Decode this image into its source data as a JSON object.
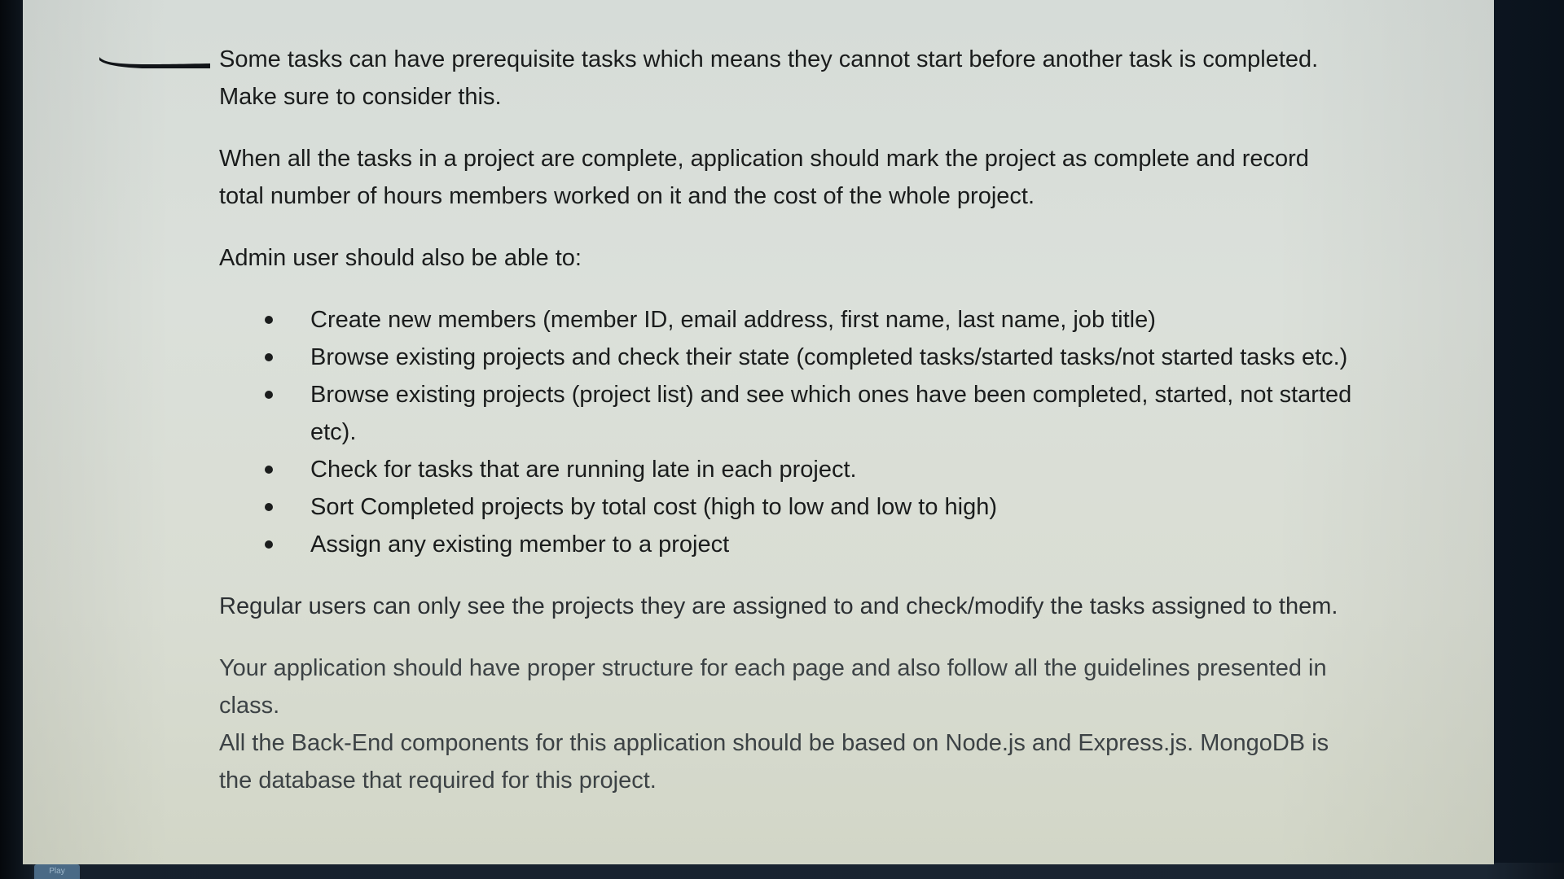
{
  "document": {
    "paragraphs_top": [
      "Some tasks can have prerequisite tasks which means they cannot start before another task is completed. Make sure to consider this.",
      "When all the tasks in a project are complete, application should mark the project as complete and record total number of hours members worked on it and the cost of the whole project.",
      "Admin user should also be able to:"
    ],
    "bullets": [
      "Create new members (member ID, email address, first name, last name, job title)",
      "Browse existing projects and check their state (completed tasks/started tasks/not started tasks etc.)",
      "Browse existing projects (project list) and see which ones have been completed, started, not started etc).",
      "Check for tasks that are running late in each project.",
      "Sort Completed projects by total cost (high to low and low to high)",
      "Assign any existing member to a project"
    ],
    "paragraphs_bottom": [
      "Regular users can only see the projects they are assigned to and check/modify the tasks assigned to them.",
      "Your application should have proper structure for each page and also follow all the guidelines presented in class.",
      "All the Back-End components for this application should be based on Node.js and Express.js. MongoDB is the database that required for this project."
    ]
  },
  "taskbar": {
    "play_label": "Play"
  },
  "colors": {
    "page_background": "#d9ddd6",
    "text": "#1a1c1c",
    "marker": "#111418"
  }
}
